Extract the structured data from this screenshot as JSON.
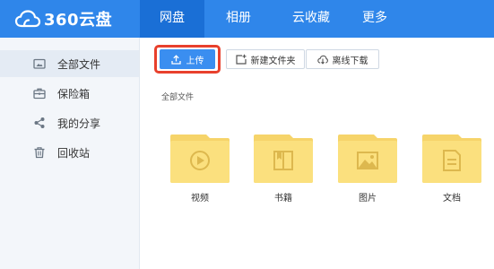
{
  "app": {
    "logo_text": "360云盘"
  },
  "nav": {
    "items": [
      {
        "label": "网盘",
        "active": true
      },
      {
        "label": "相册",
        "active": false
      },
      {
        "label": "云收藏",
        "active": false
      },
      {
        "label": "更多",
        "active": false
      }
    ]
  },
  "sidebar": {
    "items": [
      {
        "label": "全部文件",
        "icon": "all-files-icon",
        "active": true
      },
      {
        "label": "保险箱",
        "icon": "safe-box-icon",
        "active": false
      },
      {
        "label": "我的分享",
        "icon": "share-icon",
        "active": false
      },
      {
        "label": "回收站",
        "icon": "trash-icon",
        "active": false
      }
    ]
  },
  "toolbar": {
    "upload_label": "上传",
    "new_folder_label": "新建文件夹",
    "offline_download_label": "离线下载"
  },
  "breadcrumb": {
    "current": "全部文件"
  },
  "files": [
    {
      "name": "视频",
      "icon": "video-icon"
    },
    {
      "name": "书籍",
      "icon": "book-icon"
    },
    {
      "name": "图片",
      "icon": "image-icon"
    },
    {
      "name": "文档",
      "icon": "document-icon"
    }
  ],
  "colors": {
    "header": "#2f86ea",
    "header_active": "#1a6fd6",
    "upload_button": "#3a8ef0",
    "highlight": "#e8402c",
    "folder": "#fbe07e",
    "folder_tab": "#f6d46a",
    "folder_glyph": "#ddb84e"
  }
}
